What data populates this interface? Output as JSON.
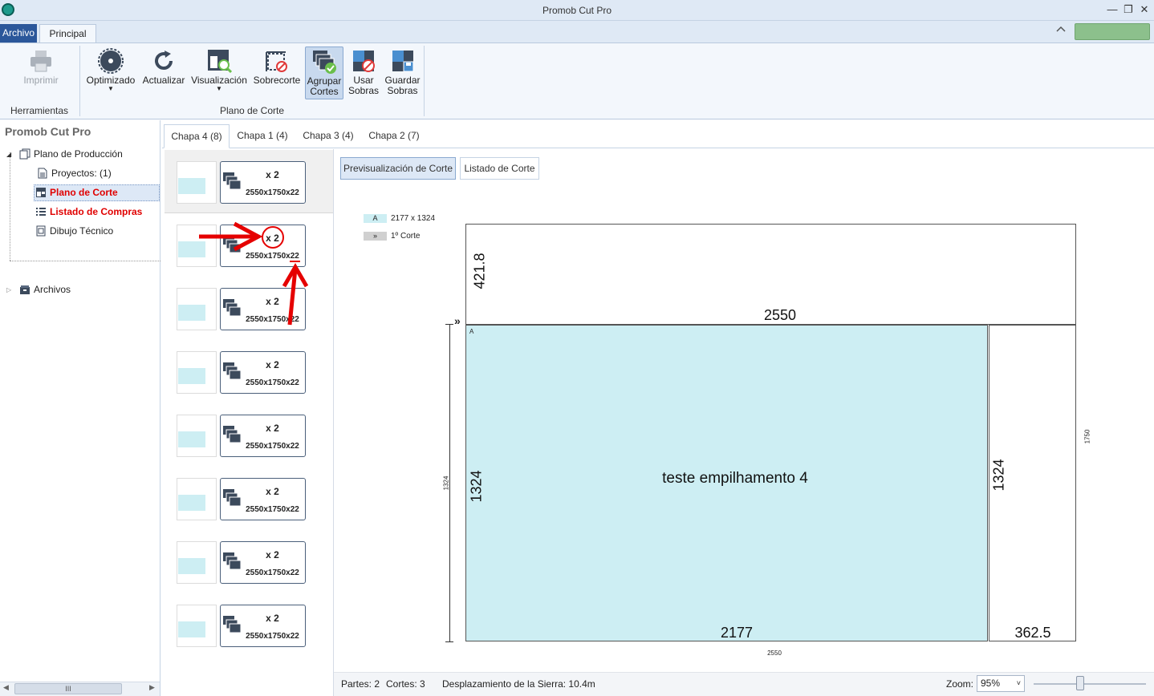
{
  "window": {
    "title": "Promob Cut Pro",
    "minimize_glyph": "—",
    "restore_glyph": "❐",
    "close_glyph": "✕"
  },
  "ribbon_tabs": {
    "file_label": "Archivo",
    "home_label": "Principal"
  },
  "ribbon": {
    "print_label": "Imprimir",
    "tools_group_label": "Herramientas",
    "optimized_label": "Optimizado",
    "refresh_label": "Actualizar",
    "visualization_label": "Visualización",
    "overcut_label": "Sobrecorte",
    "group_cuts_label_1": "Agrupar",
    "group_cuts_label_2": "Cortes",
    "use_leftovers_label_1": "Usar",
    "use_leftovers_label_2": "Sobras",
    "save_leftovers_label_1": "Guardar",
    "save_leftovers_label_2": "Sobras",
    "cut_plan_group_label": "Plano de Corte"
  },
  "sidebar": {
    "title": "Promob Cut Pro",
    "items": [
      {
        "label": "Plano de Producción"
      },
      {
        "label": "Proyectos: (1)"
      },
      {
        "label": "Plano de Corte"
      },
      {
        "label": "Listado de Compras"
      },
      {
        "label": "Dibujo Técnico"
      },
      {
        "label": "Archivos"
      }
    ],
    "scroll_thumb_glyph": "III"
  },
  "sheet_tabs": [
    {
      "label": "Chapa 4 (8)"
    },
    {
      "label": "Chapa 1 (4)"
    },
    {
      "label": "Chapa 3 (4)"
    },
    {
      "label": "Chapa 2 (7)"
    }
  ],
  "sheets_list": [
    {
      "qty": "x 2",
      "dims": "2550x1750x22"
    },
    {
      "qty": "x 2",
      "dims": "2550x1750x22"
    },
    {
      "qty": "x 2",
      "dims": "2550x1750x22"
    },
    {
      "qty": "x 2",
      "dims": "2550x1750x22"
    },
    {
      "qty": "x 2",
      "dims": "2550x1750x22"
    },
    {
      "qty": "x 2",
      "dims": "2550x1750x22"
    },
    {
      "qty": "x 2",
      "dims": "2550x1750x22"
    },
    {
      "qty": "x 2",
      "dims": "2550x1750x22"
    }
  ],
  "view_buttons": {
    "preview_label": "Previsualización de Corte",
    "list_label": "Listado de Corte"
  },
  "legend": {
    "piece_code": "A",
    "piece_dims": "2177 x 1324",
    "cut_glyph": "»",
    "cut_label": "1º Corte"
  },
  "drawing": {
    "top_strip_height": "421.8",
    "top_strip_width": "2550",
    "piece_label": "A",
    "piece_name": "teste empilhamento 4",
    "piece_height": "1324",
    "piece_width": "2177",
    "right_height": "1324",
    "right_width": "362.5",
    "sheet_height_small": "1750",
    "left_dim_small": "1324",
    "bottom_dim_small": "2550",
    "cut_marker": "»"
  },
  "statusbar": {
    "parts": "Partes: 2",
    "cuts": "Cortes: 3",
    "saw_travel": "Desplazamiento de la Sierra: 10.4m",
    "zoom_label": "Zoom:",
    "zoom_value": "95%"
  }
}
